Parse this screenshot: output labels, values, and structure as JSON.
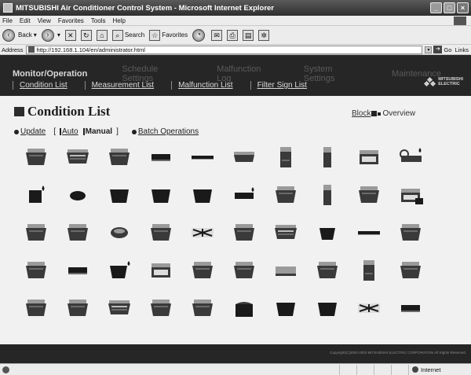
{
  "window": {
    "title": "MITSUBISHI Air Conditioner Control System - Microsoft Internet Explorer"
  },
  "menu": [
    "File",
    "Edit",
    "View",
    "Favorites",
    "Tools",
    "Help"
  ],
  "toolbar": {
    "back": "Back",
    "search": "Search",
    "favorites": "Favorites"
  },
  "address": {
    "label": "Address",
    "url": "http://192.168.1.104/en/administrator.html",
    "go": "Go",
    "links": "Links"
  },
  "nav": {
    "brand": "Monitor/Operation",
    "items": [
      "Schedule Settings",
      "Malfunction Log",
      "System Settings",
      "Maintenance"
    ],
    "subitems": [
      "Condition List",
      "Measurement List",
      "Malfunction List",
      "Filter Sign List"
    ]
  },
  "logo": {
    "line1": "MITSUBISHI",
    "line2": "ELECTRIC"
  },
  "page": {
    "title": "Condition List",
    "block_link": "Block",
    "overview_label": "Overview",
    "update_link": "Update",
    "bracket_open": "[",
    "bracket_close": "]",
    "auto_link": "Auto",
    "manual_label": "Manual",
    "batch_link": "Batch Operations"
  },
  "units": [
    [
      "ceiling-4way",
      "ceiling-4way-wide",
      "ceiling-4way",
      "wall-slim",
      "wall-thin",
      "ceiling-4way-flat",
      "floor-tall",
      "floor-tall-slim",
      "ceiling-grille",
      "lossnay-unit"
    ],
    [
      "hot-water-unit",
      "round-cassette",
      "trapezoid",
      "trapezoid",
      "trapezoid",
      "wall-drop",
      "ceiling-4way",
      "floor-tall-slim",
      "ceiling-4way",
      "ceiling-grille-flag"
    ],
    [
      "ceiling-4way",
      "ceiling-4way",
      "round-ceiling",
      "ceiling-4way",
      "cross-flow",
      "ceiling-4way",
      "ceiling-4way-wide",
      "trapezoid-small",
      "wall-thin",
      "ceiling-4way"
    ],
    [
      "ceiling-4way",
      "wall-slim",
      "trapezoid-drop",
      "ceiling-grille",
      "ceiling-4way",
      "ceiling-4way",
      "wall-mid",
      "ceiling-4way",
      "floor-tall",
      "ceiling-4way"
    ],
    [
      "ceiling-4way",
      "ceiling-4way",
      "ceiling-4way-wide",
      "ceiling-4way",
      "ceiling-4way",
      "ceiling-grille-dark",
      "trapezoid",
      "trapezoid",
      "cross-flow",
      "wall-slim"
    ]
  ],
  "footer": {
    "copyright": "Copyright(C)2002-2003 MITSUBISHI ELECTRIC CORPORATION All Rights Reserved."
  },
  "status": {
    "zone": "Internet"
  }
}
